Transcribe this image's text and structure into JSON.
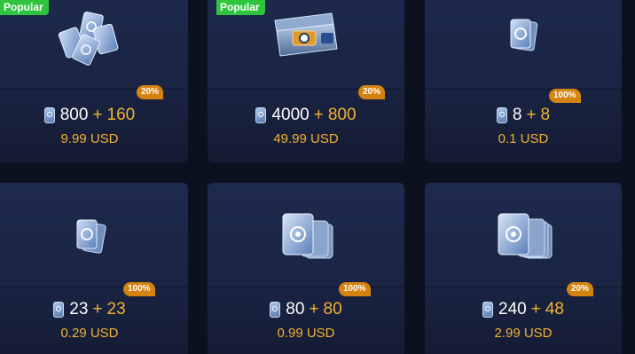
{
  "products": [
    {
      "popular": "Popular",
      "badge": "20%",
      "base": "800",
      "plus": "+",
      "bonus": "160",
      "price": "9.99 USD",
      "art_icon": "card-pile-icon"
    },
    {
      "popular": "Popular",
      "badge": "20%",
      "base": "4000",
      "plus": "+",
      "bonus": "800",
      "price": "49.99 USD",
      "art_icon": "treasure-chest-icon"
    },
    {
      "popular": "",
      "badge": "100%",
      "base": "8",
      "plus": "+",
      "bonus": "8",
      "price": "0.1 USD",
      "art_icon": "single-card-icon"
    },
    {
      "popular": "",
      "badge": "100%",
      "base": "23",
      "plus": "+",
      "bonus": "23",
      "price": "0.29 USD",
      "art_icon": "card-pair-icon"
    },
    {
      "popular": "",
      "badge": "100%",
      "base": "80",
      "plus": "+",
      "bonus": "80",
      "price": "0.99 USD",
      "art_icon": "card-stack-icon"
    },
    {
      "popular": "",
      "badge": "20%",
      "base": "240",
      "plus": "+",
      "bonus": "48",
      "price": "2.99 USD",
      "art_icon": "card-stack-large-icon"
    }
  ],
  "colors": {
    "background": "#0c1120",
    "card": "#1e2a4d",
    "popular_badge": "#2ec43e",
    "bonus_badge": "#d48310",
    "bonus_text": "#f2b233",
    "price_text": "#f2b233"
  }
}
